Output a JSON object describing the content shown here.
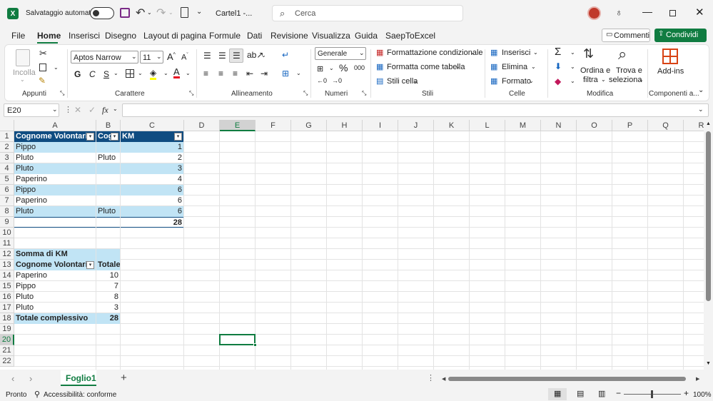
{
  "titlebar": {
    "autosave_label": "Salvataggio automatico",
    "file_title": "Cartel1  -...",
    "search_placeholder": "Cerca"
  },
  "menu": {
    "items": [
      "File",
      "Home",
      "Inserisci",
      "Disegno",
      "Layout di pagina",
      "Formule",
      "Dati",
      "Revisione",
      "Visualizza",
      "Guida",
      "SaepToExcel"
    ],
    "active": "Home",
    "comments_label": "Commenti",
    "share_label": "Condividi"
  },
  "ribbon": {
    "paste_label": "Incolla",
    "font_name": "Aptos Narrow",
    "font_size": "11",
    "bold": "G",
    "italic": "C",
    "underline": "S",
    "number_format": "Generale",
    "cond_format": "Formattazione condizionale",
    "format_table": "Formatta come tabella",
    "cell_styles": "Stili cella",
    "insert": "Inserisci",
    "delete": "Elimina",
    "format": "Formato",
    "sort_filter_1": "Ordina e",
    "sort_filter_2": "filtra",
    "find_select_1": "Trova e",
    "find_select_2": "seleziona",
    "addins": "Add-ins",
    "groups": [
      "Appunti",
      "Carattere",
      "Allineamento",
      "Numeri",
      "Stili",
      "Celle",
      "Modifica",
      "Componenti a..."
    ]
  },
  "formula": {
    "name_box": "E20",
    "fx": "fx",
    "value": ""
  },
  "columns": [
    "A",
    "B",
    "C",
    "D",
    "E",
    "F",
    "G",
    "H",
    "I",
    "J",
    "K",
    "L",
    "M",
    "N",
    "O",
    "P",
    "Q",
    "R"
  ],
  "rows": [
    "1",
    "2",
    "3",
    "4",
    "5",
    "6",
    "7",
    "8",
    "9",
    "10",
    "11",
    "12",
    "13",
    "14",
    "15",
    "16",
    "17",
    "18",
    "19",
    "20",
    "21",
    "22"
  ],
  "table": {
    "headers": [
      "Cognome Volontario",
      "Cog",
      "KM"
    ],
    "rows": [
      [
        "Pippo",
        "",
        "1"
      ],
      [
        "Pluto",
        "Pluto",
        "2"
      ],
      [
        "Pluto",
        "",
        "3"
      ],
      [
        "Paperino",
        "",
        "4"
      ],
      [
        "Pippo",
        "",
        "6"
      ],
      [
        "Paperino",
        "",
        "6"
      ],
      [
        "Pluto",
        "Pluto",
        "6"
      ]
    ],
    "total": "28"
  },
  "pivot": {
    "title": "Somma di KM",
    "row_label": "Cognome Volontario",
    "value_label": "Totale",
    "rows": [
      [
        "Paperino",
        "10"
      ],
      [
        "Pippo",
        "7"
      ],
      [
        "Pluto",
        "8"
      ],
      [
        "Pluto",
        "3"
      ]
    ],
    "grand_total_label": "Totale complessivo",
    "grand_total": "28"
  },
  "sheets": {
    "active": "Foglio1"
  },
  "status": {
    "ready": "Pronto",
    "accessibility": "Accessibilità: conforme",
    "zoom": "100%"
  },
  "colors": {
    "excel_green": "#107c41",
    "table_header": "#0f4c81",
    "band": "#c1e4f5",
    "selection": "#107c41"
  }
}
